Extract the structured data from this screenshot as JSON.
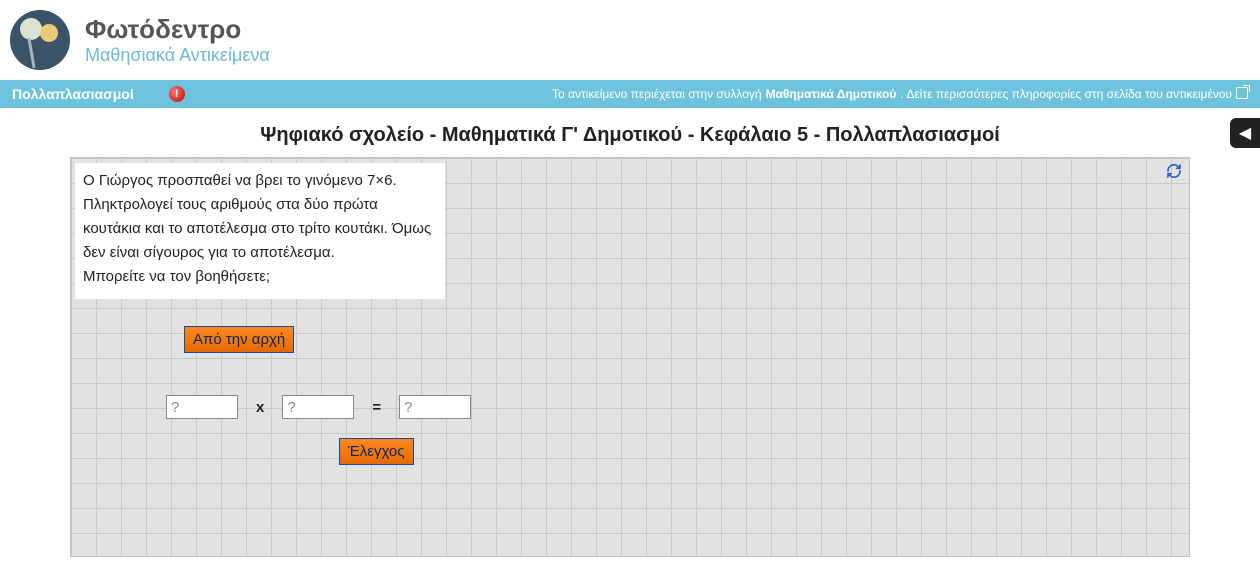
{
  "header": {
    "site_title": "Φωτόδεντρο",
    "site_subtitle": "Μαθησιακά Αντικείμενα"
  },
  "bluebar": {
    "left_title": "Πολλαπλασιασμοί",
    "alert_symbol": "!",
    "info_prefix": "Το αντικείμενο περιέχεται στην συλλογή ",
    "info_bold": "Μαθηματικά Δημοτικού",
    "info_suffix": ". Δείτε περισσότερες πληροφορίες στη σελίδα του αντικειμένου"
  },
  "page_title": "Ψηφιακό σχολείο - Μαθηματικά Γ' Δημοτικού - Κεφάλαιο 5 - Πολλαπλασιασμοί",
  "side_tab_glyph": "◀",
  "instruction": {
    "line1": "Ο Γιώργος προσπαθεί να βρει το γινόμενο 7×6.",
    "line2": "Πληκτρολογεί τους αριθμούς στα δύο πρώτα κουτάκια και το αποτέλεσμα στο τρίτο κουτάκι. Όμως δεν είναι σίγουρος για το αποτέλεσμα.",
    "line3": "Μπορείτε να τον βοηθήσετε;"
  },
  "buttons": {
    "restart": "Από την αρχή",
    "check": "Έλεγχος"
  },
  "calc": {
    "value1": "?",
    "times": "x",
    "value2": "?",
    "equals": "=",
    "value3": "?"
  }
}
